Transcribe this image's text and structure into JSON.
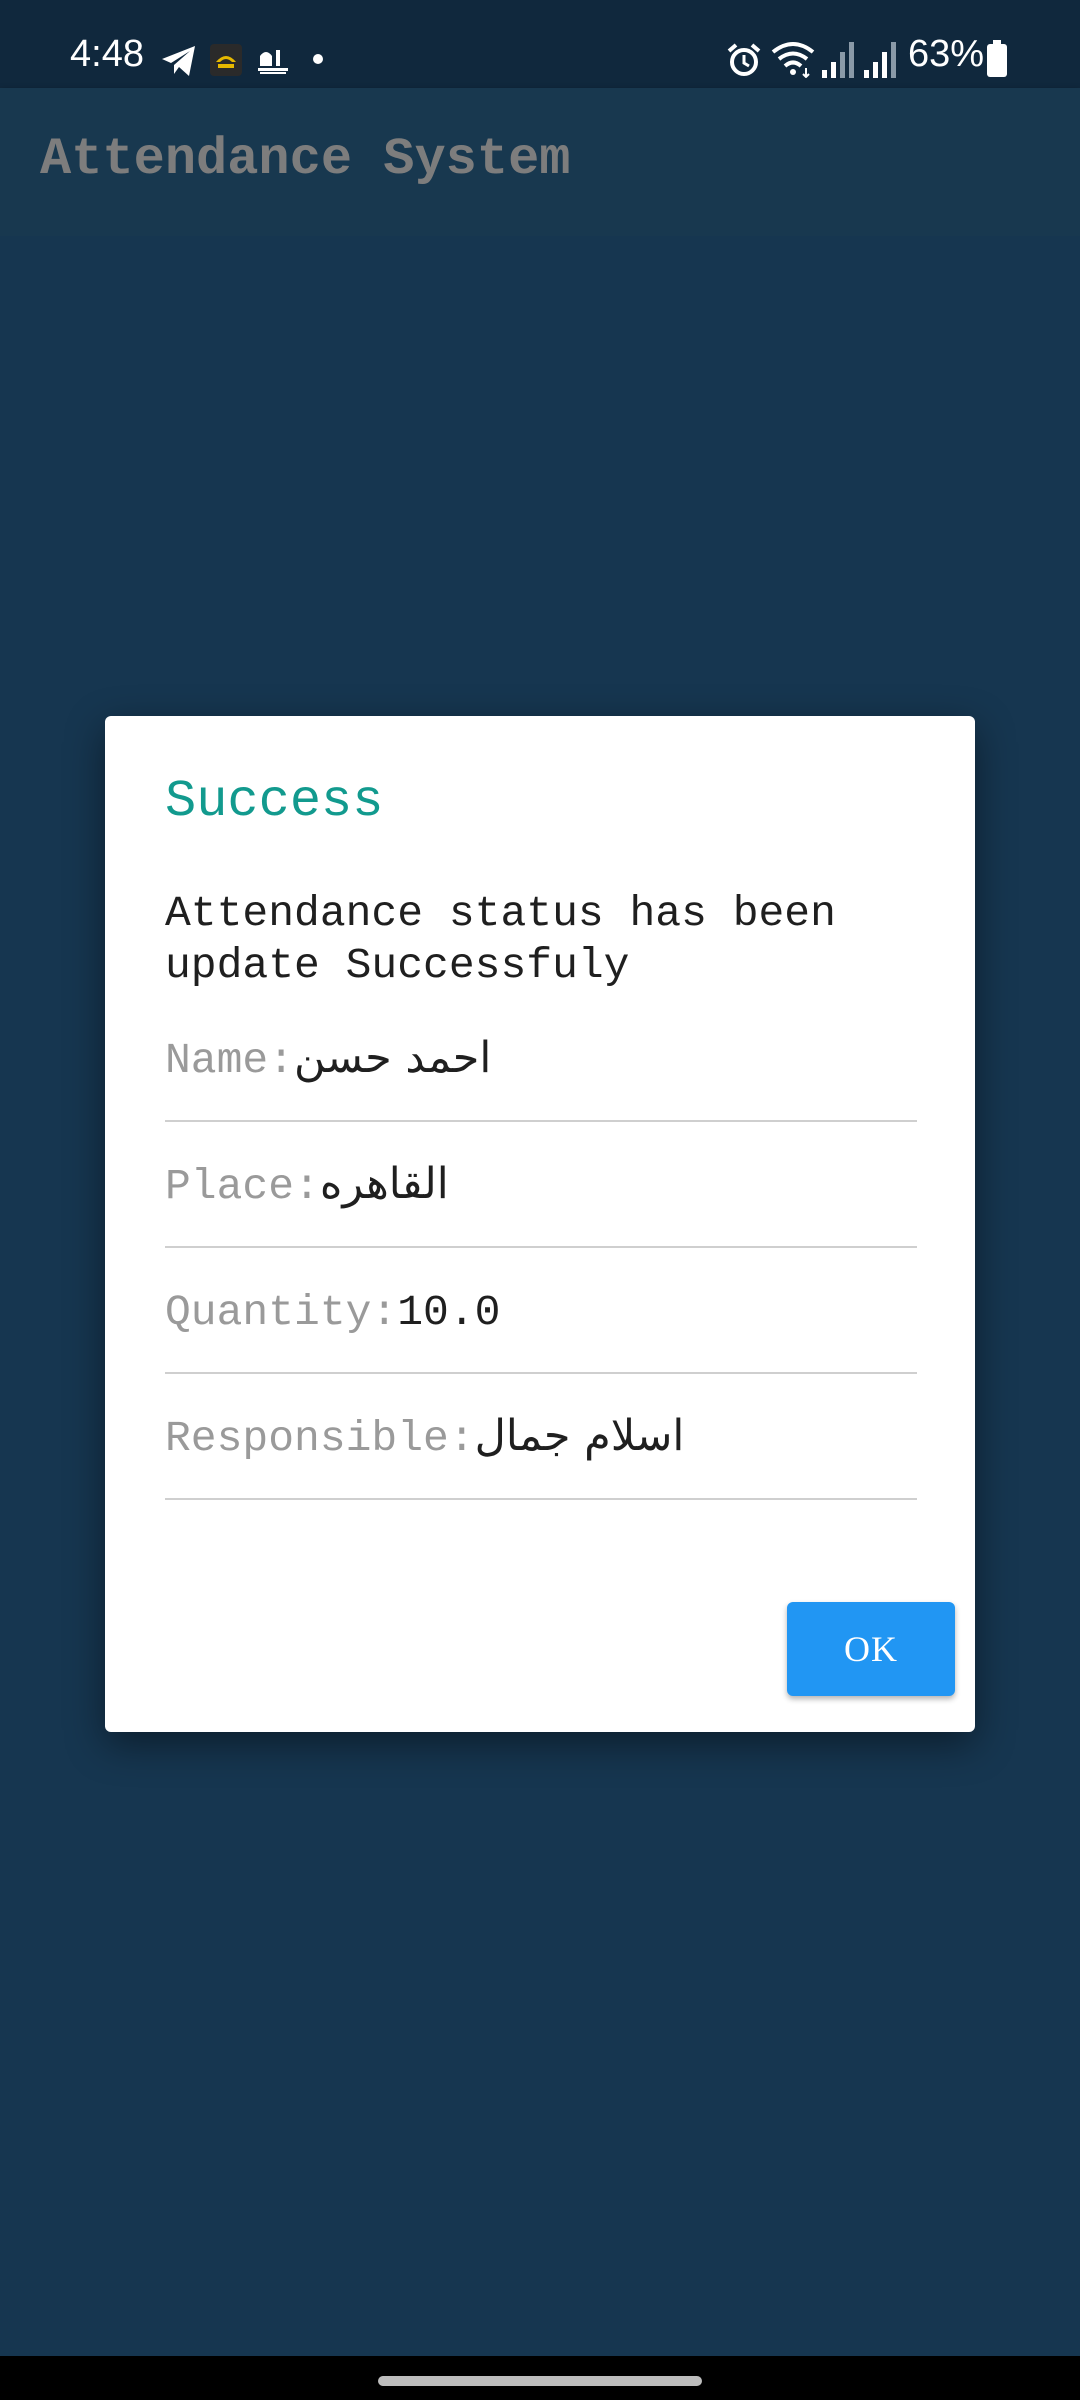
{
  "status_bar": {
    "time": "4:48",
    "battery_percent": "63%",
    "icons": [
      "telegram-icon",
      "app-notification-icon",
      "mosque-app-icon",
      "notification-dot-icon",
      "alarm-icon",
      "wifi-icon",
      "signal-icon",
      "signal-icon",
      "battery-icon"
    ]
  },
  "app_bar": {
    "title": "Attendance System"
  },
  "dialog": {
    "title": "Success",
    "message": "Attendance status has been update Successfuly",
    "fields": [
      {
        "label": "Name:",
        "value": "احمد حسن"
      },
      {
        "label": "Place:",
        "value": "القاهره"
      },
      {
        "label": "Quantity:",
        "value": "10.0"
      },
      {
        "label": "Responsible:",
        "value": "اسلام جمال"
      }
    ],
    "ok_label": "OK"
  },
  "colors": {
    "background": "#163650",
    "status_bar": "#10283d",
    "app_bar": "#18384f",
    "app_title": "#7d7d7d",
    "dialog_title": "#129a8e",
    "ok_button": "#2196f3"
  }
}
